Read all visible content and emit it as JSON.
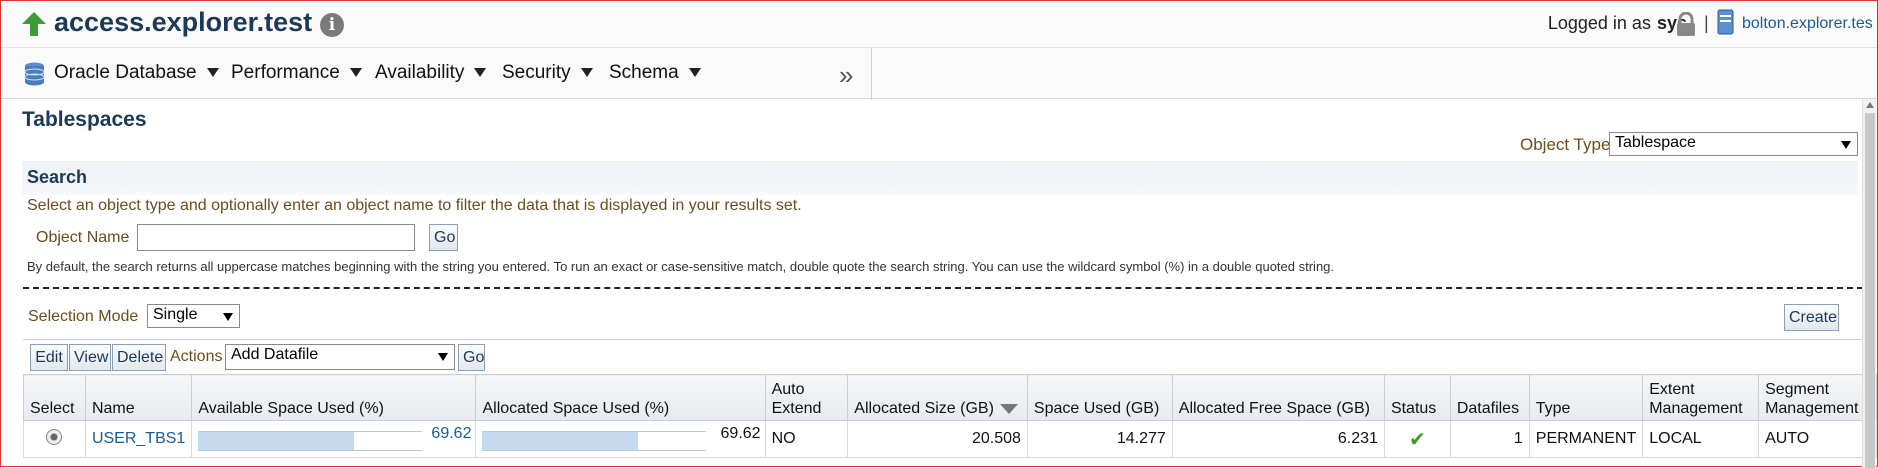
{
  "header": {
    "site_title": "access.explorer.test",
    "logged_in_label": "Logged in as",
    "user": "sys",
    "separator": "|",
    "host": "bolton.explorer.tes"
  },
  "menu": {
    "items": [
      {
        "label": "Oracle Database"
      },
      {
        "label": "Performance"
      },
      {
        "label": "Availability"
      },
      {
        "label": "Security"
      },
      {
        "label": "Schema"
      }
    ],
    "more_icon": "»"
  },
  "page": {
    "title": "Tablespaces",
    "object_type_label": "Object Type",
    "object_type_value": "Tablespace"
  },
  "search": {
    "title": "Search",
    "description": "Select an object type and optionally enter an object name to filter the data that is displayed in your results set.",
    "object_name_label": "Object Name",
    "object_name_value": "",
    "go_label": "Go",
    "help": "By default, the search returns all uppercase matches beginning with the string you entered. To run an exact or case-sensitive match, double quote the search string. You can use the wildcard symbol (%) in a double quoted string."
  },
  "toolbar": {
    "selection_mode_label": "Selection Mode",
    "selection_mode_value": "Single",
    "create_label": "Create",
    "edit_label": "Edit",
    "view_label": "View",
    "delete_label": "Delete",
    "actions_label": "Actions",
    "actions_value": "Add Datafile",
    "go_label": "Go"
  },
  "table": {
    "columns": {
      "select": "Select",
      "name": "Name",
      "available_used": "Available Space Used (%)",
      "allocated_used": "Allocated Space Used (%)",
      "auto_extend_1": "Auto",
      "auto_extend_2": "Extend",
      "allocated_size": "Allocated Size (GB)",
      "space_used": "Space Used (GB)",
      "allocated_free": "Allocated Free Space (GB)",
      "status": "Status",
      "datafiles": "Datafiles",
      "type": "Type",
      "extent_1": "Extent",
      "extent_2": "Management",
      "segment_1": "Segment",
      "segment_2": "Management"
    },
    "rows": [
      {
        "name": "USER_TBS1",
        "available_used": "69.62",
        "available_used_pct": 69.62,
        "allocated_used": "69.62",
        "allocated_used_pct": 69.62,
        "auto_extend": "NO",
        "allocated_size": "20.508",
        "space_used": "14.277",
        "allocated_free": "6.231",
        "status_icon": "check-icon",
        "datafiles": "1",
        "type": "PERMANENT",
        "extent_management": "LOCAL",
        "segment_management": "AUTO"
      }
    ]
  },
  "colors": {
    "title_blue": "#1b3a57",
    "label_brown": "#6b4d1e",
    "link_blue": "#1a5a96",
    "bar_fill": "#c5d9ef",
    "status_green": "#3a9a2a"
  }
}
